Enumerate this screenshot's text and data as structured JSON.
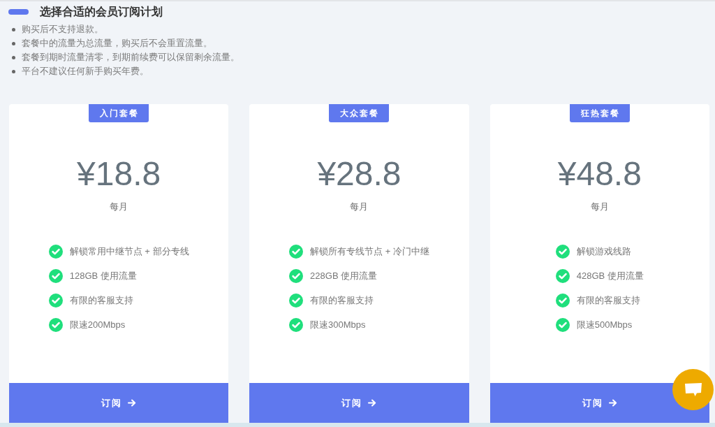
{
  "header": {
    "title": "选择合适的会员订阅计划"
  },
  "notes": [
    "购买后不支持退款。",
    "套餐中的流量为总流量，购买后不会重置流量。",
    "套餐到期时流量清零，到期前续费可以保留剩余流量。",
    "平台不建议任何新手购买年费。"
  ],
  "plans": [
    {
      "badge": "入门套餐",
      "price": "¥18.8",
      "period": "每月",
      "features": [
        "解锁常用中继节点 + 部分专线",
        "128GB 使用流量",
        "有限的客服支持",
        "限速200Mbps"
      ],
      "button": "订阅"
    },
    {
      "badge": "大众套餐",
      "price": "¥28.8",
      "period": "每月",
      "features": [
        "解锁所有专线节点 + 冷门中继",
        "228GB 使用流量",
        "有限的客服支持",
        "限速300Mbps"
      ],
      "button": "订阅"
    },
    {
      "badge": "狂热套餐",
      "price": "¥48.8",
      "period": "每月",
      "features": [
        "解锁游戏线路",
        "428GB 使用流量",
        "有限的客服支持",
        "限速500Mbps"
      ],
      "button": "订阅"
    }
  ]
}
